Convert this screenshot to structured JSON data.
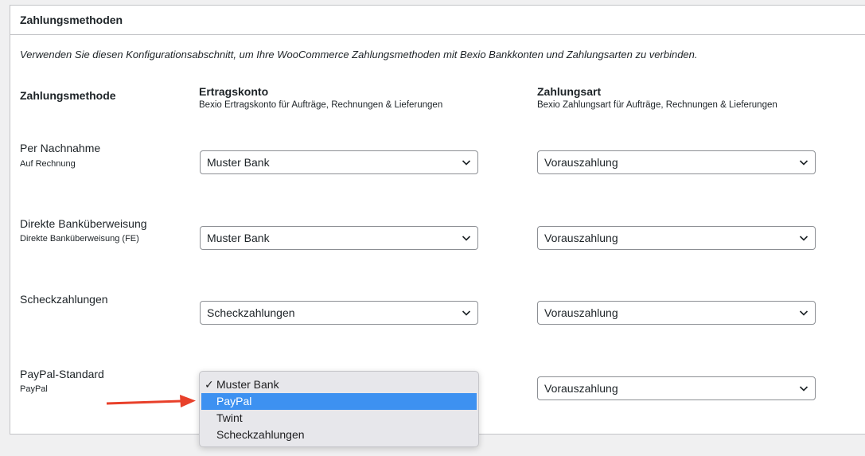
{
  "section": {
    "title": "Zahlungsmethoden",
    "description": "Verwenden Sie diesen Konfigurationsabschnitt, um Ihre WooCommerce Zahlungsmethoden mit Bexio Bankkonten und Zahlungsarten zu verbinden."
  },
  "columns": {
    "method": "Zahlungsmethode",
    "revenue": {
      "title": "Ertragskonto",
      "subtitle": "Bexio Ertragskonto für Aufträge, Rechnungen & Lieferungen"
    },
    "payment_type": {
      "title": "Zahlungsart",
      "subtitle": "Bexio Zahlungsart für Aufträge, Rechnungen & Lieferungen"
    }
  },
  "rows": [
    {
      "name": "Per Nachnahme",
      "sub": "Auf Rechnung",
      "revenue": "Muster Bank",
      "payment_type": "Vorauszahlung"
    },
    {
      "name": "Direkte Banküberweisung",
      "sub": "Direkte Banküberweisung (FE)",
      "revenue": "Muster Bank",
      "payment_type": "Vorauszahlung"
    },
    {
      "name": "Scheckzahlungen",
      "sub": "",
      "revenue": "Scheckzahlungen",
      "payment_type": "Vorauszahlung"
    },
    {
      "name": "PayPal-Standard",
      "sub": "PayPal",
      "revenue": "",
      "payment_type": "Vorauszahlung"
    }
  ],
  "dropdown": {
    "checkmark": "✓",
    "options": [
      "Muster Bank",
      "PayPal",
      "Twint",
      "Scheckzahlungen"
    ],
    "checked_index": 0,
    "highlighted_index": 1
  },
  "colors": {
    "highlight": "#3d91f1",
    "annotation_arrow": "#e8402a"
  }
}
